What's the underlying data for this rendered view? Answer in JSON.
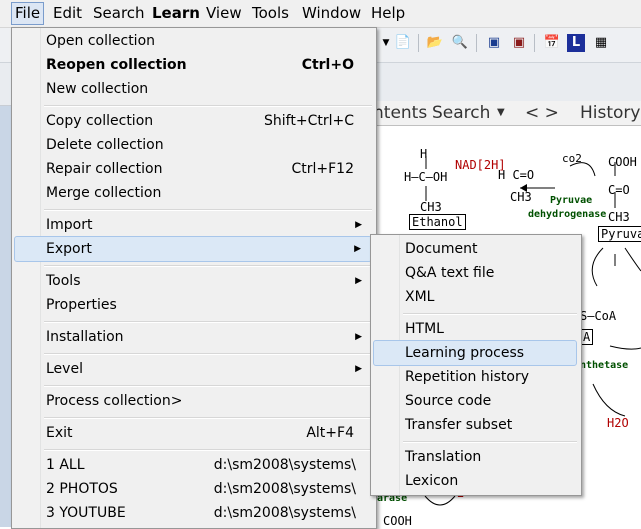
{
  "menubar": [
    "File",
    "Edit",
    "Search",
    "Learn",
    "View",
    "Tools",
    "Window",
    "Help"
  ],
  "tabs": {
    "contents": "ntents",
    "search": "Search",
    "nav": "<   >",
    "history": "History"
  },
  "file_menu": {
    "items": [
      {
        "label": "Open collection",
        "shortcut": ""
      },
      {
        "label": "Reopen collection",
        "shortcut": "Ctrl+O"
      },
      {
        "label": "New collection",
        "shortcut": ""
      },
      {
        "label": "Copy collection",
        "shortcut": "Shift+Ctrl+C"
      },
      {
        "label": "Delete collection",
        "shortcut": ""
      },
      {
        "label": "Repair collection",
        "shortcut": "Ctrl+F12"
      },
      {
        "label": "Merge collection",
        "shortcut": ""
      },
      {
        "label": "Import",
        "shortcut": ""
      },
      {
        "label": "Export",
        "shortcut": ""
      },
      {
        "label": "Tools",
        "shortcut": ""
      },
      {
        "label": "Properties",
        "shortcut": ""
      },
      {
        "label": "Installation",
        "shortcut": ""
      },
      {
        "label": "Level",
        "shortcut": ""
      },
      {
        "label": "Process collection>",
        "shortcut": ""
      },
      {
        "label": "Exit",
        "shortcut": "Alt+F4"
      },
      {
        "label": "1 ALL",
        "shortcut": "d:\\sm2008\\systems\\"
      },
      {
        "label": "2 PHOTOS",
        "shortcut": "d:\\sm2008\\systems\\"
      },
      {
        "label": "3 YOUTUBE",
        "shortcut": "d:\\sm2008\\systems\\"
      }
    ]
  },
  "export_menu": {
    "items": [
      {
        "label": "Document"
      },
      {
        "label": "Q&A text file"
      },
      {
        "label": "XML"
      },
      {
        "label": "HTML"
      },
      {
        "label": "Learning process"
      },
      {
        "label": "Repetition history"
      },
      {
        "label": "Source code"
      },
      {
        "label": "Transfer subset"
      },
      {
        "label": "Translation"
      },
      {
        "label": "Lexicon"
      }
    ]
  },
  "diagram": {
    "h": "H",
    "hcoh": "H—C—OH",
    "ch3a": "CH3",
    "ethanol": "Ethanol",
    "nad": "NAD[2H]",
    "hceo": "H C=O",
    "ch3b": "CH3",
    "co2": "co2",
    "cooh": "COOH",
    "ceo": "C=O",
    "ch3c": "CH3",
    "pyruvae": "Pyruvae",
    "dehydrogenase": "dehydrogenase",
    "pyruva": "Pyruva",
    "scoa": "S—CoA",
    "a": "A",
    "nthetase": "nthetase",
    "h2o": "H2O",
    "arase": "arase",
    "two": "2",
    "cooh2": "COOH"
  }
}
